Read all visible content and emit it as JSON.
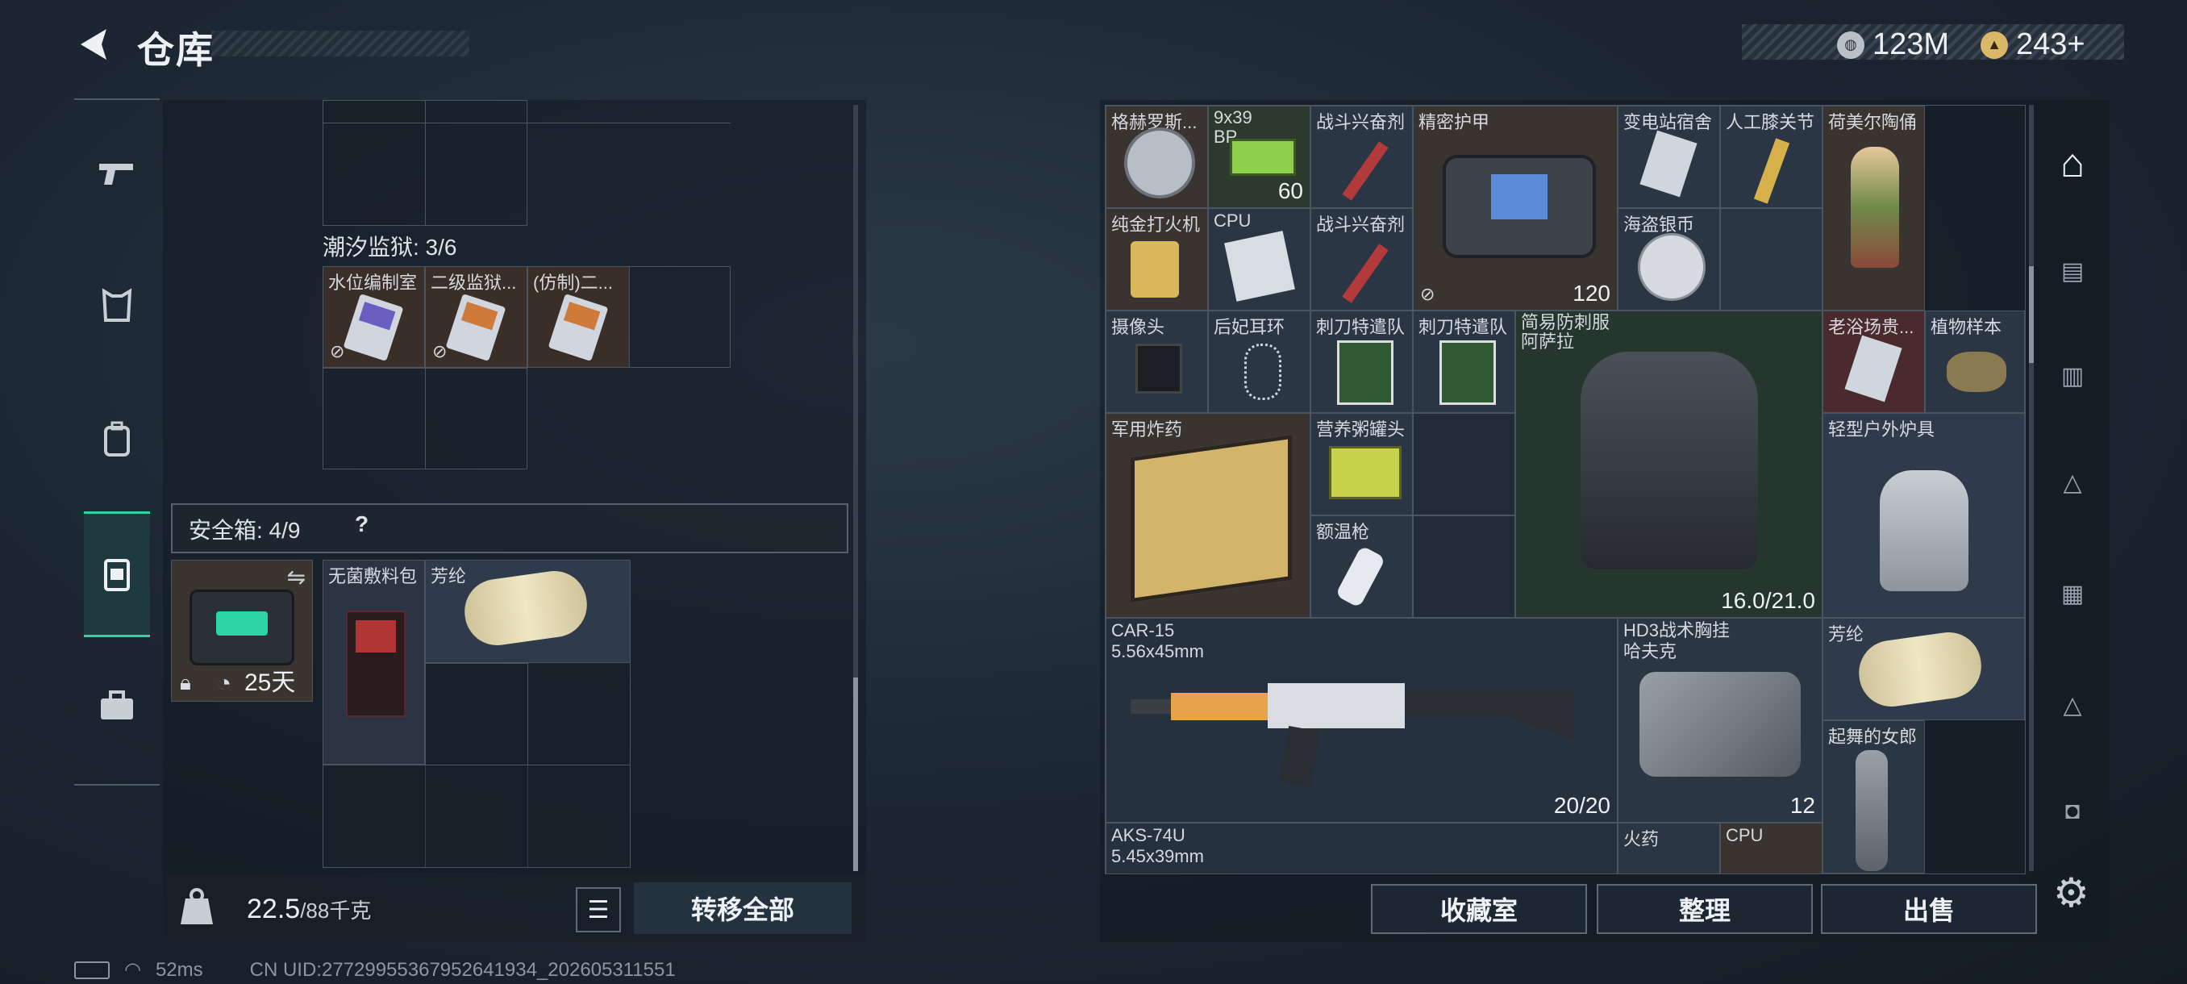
{
  "header": {
    "title": "仓库",
    "currency1": "123M",
    "currency2": "243+"
  },
  "left": {
    "tide_prison_label": "潮汐监狱: 3/6",
    "tide_items": [
      {
        "name": "水位编制室"
      },
      {
        "name": "二级监狱..."
      },
      {
        "name": "(仿制)二..."
      }
    ],
    "safe_box_label": "安全箱: 4/9",
    "safe_help": "?",
    "safe_days": "25天",
    "safe_items": [
      {
        "name": "无菌敷料包"
      },
      {
        "name": "芳纶"
      }
    ],
    "weight": "22.5",
    "weight_cap": "/88千克",
    "transfer_all": "转移全部"
  },
  "right": {
    "items": [
      {
        "id": "r1",
        "name": "格赫罗斯..."
      },
      {
        "id": "r2",
        "name": "9x39",
        "sub": "BP",
        "qty": "60"
      },
      {
        "id": "r3",
        "name": "战斗兴奋剂"
      },
      {
        "id": "r4",
        "name": "精密护甲",
        "qty": "120"
      },
      {
        "id": "r5",
        "name": "变电站宿舍"
      },
      {
        "id": "r6",
        "name": "人工膝关节"
      },
      {
        "id": "r7",
        "name": "荷美尔陶俑"
      },
      {
        "id": "r8",
        "name": "纯金打火机"
      },
      {
        "id": "r9",
        "name": "CPU"
      },
      {
        "id": "r10",
        "name": "战斗兴奋剂"
      },
      {
        "id": "r11",
        "name": "海盗银币"
      },
      {
        "id": "r12",
        "name": "摄像头"
      },
      {
        "id": "r13",
        "name": "后妃耳环"
      },
      {
        "id": "r14",
        "name": "刺刀特遣队"
      },
      {
        "id": "r15",
        "name": "刺刀特遣队"
      },
      {
        "id": "r16",
        "name": "简易防刺服",
        "sub": "阿萨拉",
        "qty": "16.0/21.0"
      },
      {
        "id": "r17",
        "name": "老浴场贵..."
      },
      {
        "id": "r18",
        "name": "植物样本"
      },
      {
        "id": "r19",
        "name": "军用炸药"
      },
      {
        "id": "r20",
        "name": "营养粥罐头"
      },
      {
        "id": "r21",
        "name": "轻型户外炉具"
      },
      {
        "id": "r22",
        "name": "额温枪"
      },
      {
        "id": "r23",
        "name": "CAR-15",
        "sub": "5.56x45mm",
        "qty": "20/20"
      },
      {
        "id": "r24",
        "name": "HD3战术胸挂",
        "sub": "哈夫克",
        "qty": "12"
      },
      {
        "id": "r25",
        "name": "芳纶"
      },
      {
        "id": "r26",
        "name": "起舞的女郎"
      },
      {
        "id": "r27",
        "name": "AKS-74U",
        "sub": "5.45x39mm"
      },
      {
        "id": "r28",
        "name": "火药"
      },
      {
        "id": "r29",
        "name": "CPU"
      }
    ],
    "btn_collection": "收藏室",
    "btn_sort": "整理",
    "btn_sell": "出售"
  },
  "status": {
    "ping": "52ms",
    "uid": "CN UID:27729955367952641934_202605311551"
  },
  "colors": {
    "accent": "#2bd6a3",
    "panel": "#18202a",
    "grid": "#4a5561"
  },
  "icons": [
    "back-arrow-icon",
    "silver-coin-icon",
    "gold-coin-icon",
    "gun-icon",
    "armor-icon",
    "backpack-icon",
    "safe-box-icon",
    "toolbox-icon",
    "lock-icon",
    "clock-icon",
    "swap-icon",
    "list-icon",
    "weight-icon",
    "gear-icon",
    "battery-icon",
    "wifi-icon"
  ]
}
